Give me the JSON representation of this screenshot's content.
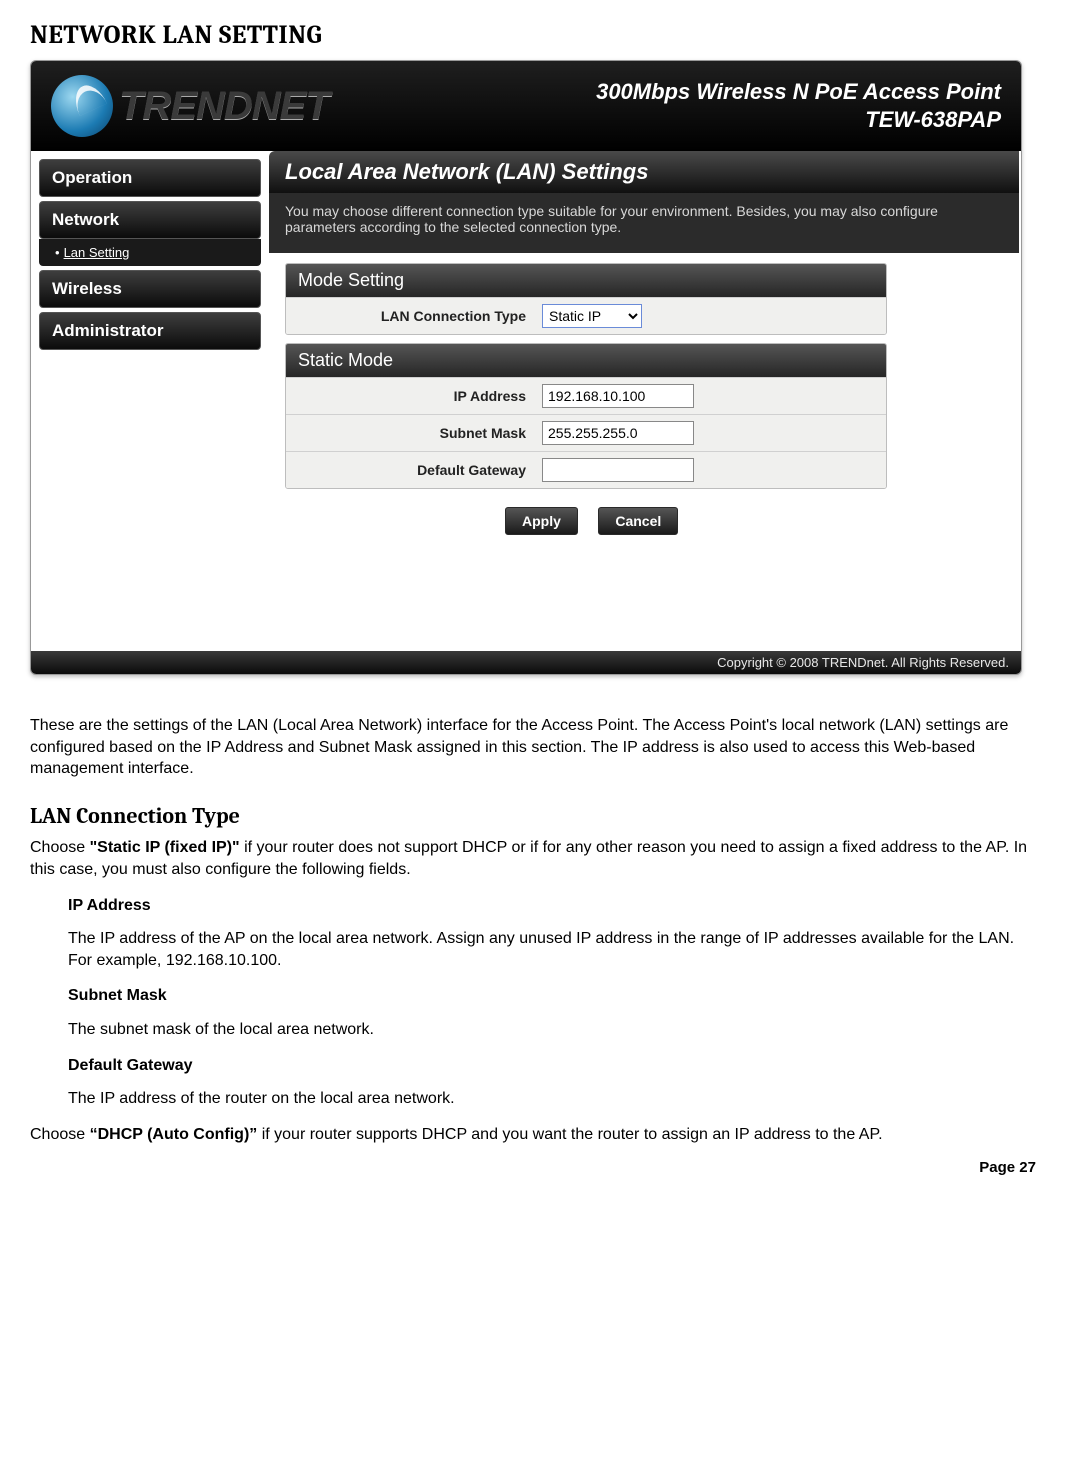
{
  "doc": {
    "heading": "NETWORK LAN SETTING",
    "intro": "These are the settings of the LAN (Local Area Network) interface for the Access Point. The Access Point's local network (LAN) settings are configured based on the IP Address and Subnet Mask assigned in this section. The IP address is also used to access this Web-based management interface.",
    "sub_heading": "LAN Connection Type",
    "choose_static_prefix": "Choose ",
    "choose_static_bold": "\"Static IP (fixed IP)\"",
    "choose_static_rest": " if your router does not support DHCP or if for any other reason you need to assign a fixed address to the AP. In this case, you must also configure the following fields.",
    "ip_label": "IP Address",
    "ip_text": "The IP address of the AP on the local area network. Assign any unused IP address in the range of IP addresses available for the LAN. For example, 192.168.10.100.",
    "subnet_label": "Subnet Mask",
    "subnet_text": "The subnet mask of the local area network.",
    "gw_label": "Default Gateway",
    "gw_text": "The IP address of the router on the local area network.",
    "choose_dhcp_prefix": "Choose ",
    "choose_dhcp_bold": "“DHCP (Auto Config)”",
    "choose_dhcp_rest": " if your router supports DHCP and you want the router to assign an IP address to the AP.",
    "page_label": "Page 27"
  },
  "ui": {
    "brand": "TRENDNET",
    "tagline1": "300Mbps Wireless N PoE Access Point",
    "tagline2": "TEW-638PAP",
    "nav": {
      "operation": "Operation",
      "network": "Network",
      "lan_setting": "Lan Setting",
      "wireless": "Wireless",
      "administrator": "Administrator"
    },
    "panel_title": "Local Area Network (LAN) Settings",
    "panel_desc": "You may choose different connection type suitable for your environment. Besides, you may also configure parameters according to the selected connection type.",
    "mode_setting_title": "Mode Setting",
    "lan_conn_label": "LAN Connection Type",
    "lan_conn_value": "Static IP",
    "static_mode_title": "Static Mode",
    "ip_label": "IP Address",
    "ip_value": "192.168.10.100",
    "subnet_label": "Subnet Mask",
    "subnet_value": "255.255.255.0",
    "gateway_label": "Default Gateway",
    "gateway_value": "",
    "apply_label": "Apply",
    "cancel_label": "Cancel",
    "copyright": "Copyright © 2008 TRENDnet. All Rights Reserved."
  }
}
